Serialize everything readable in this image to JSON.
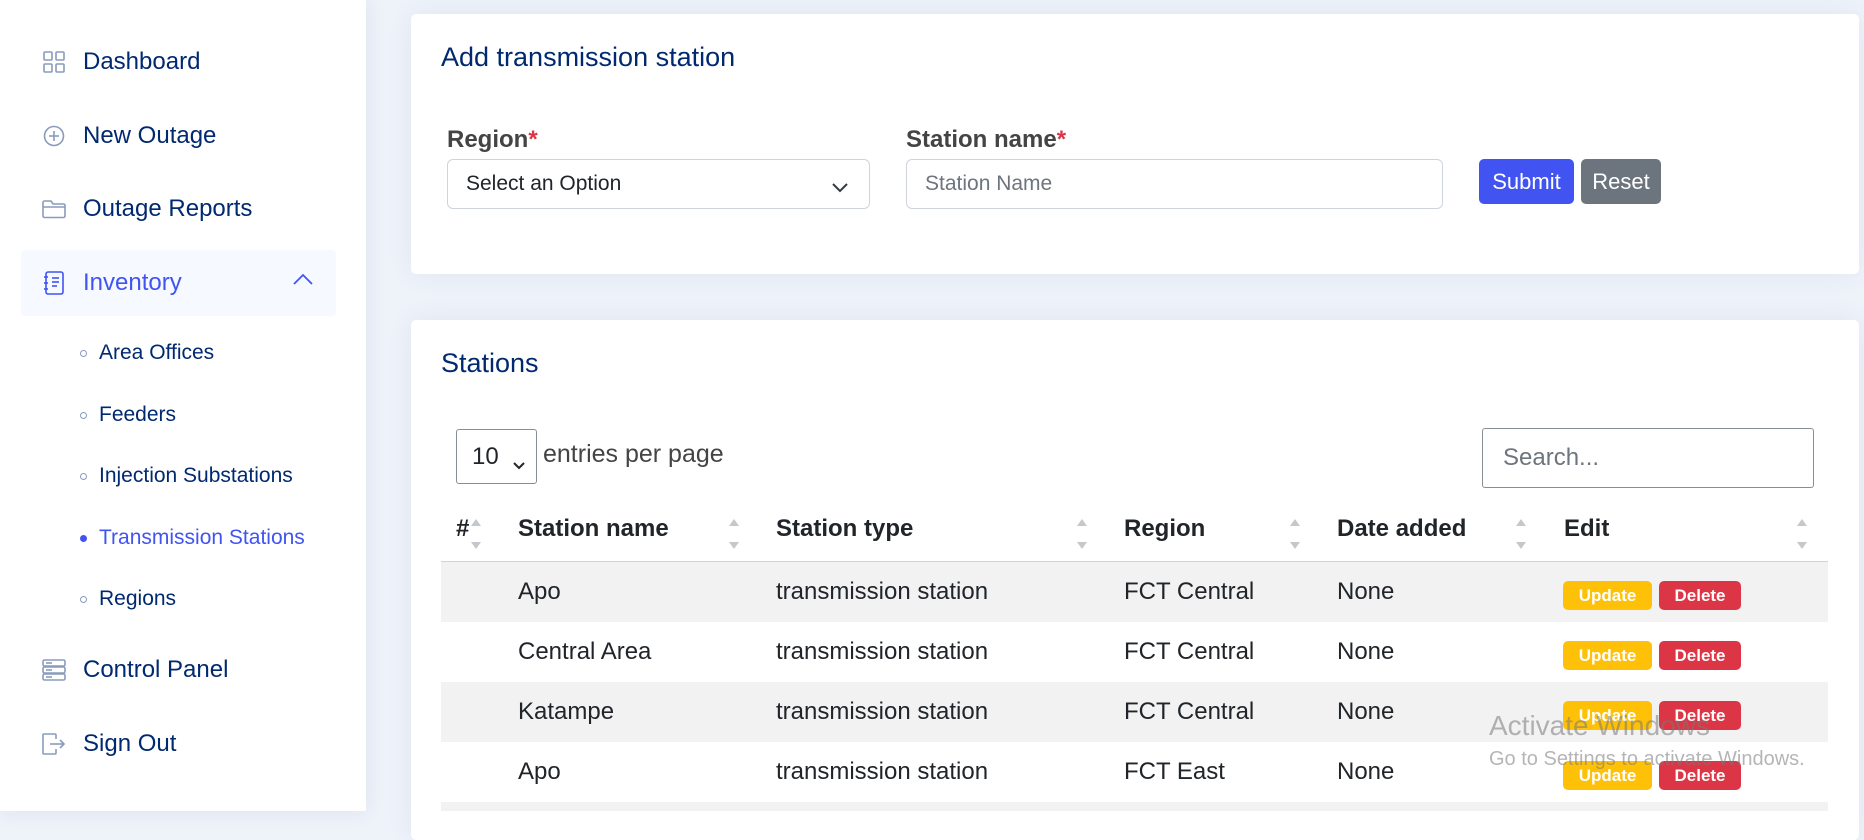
{
  "sidebar": {
    "items": [
      {
        "label": "Dashboard",
        "icon": "grid-icon"
      },
      {
        "label": "New Outage",
        "icon": "plus-circle-icon"
      },
      {
        "label": "Outage Reports",
        "icon": "folder-icon"
      },
      {
        "label": "Inventory",
        "icon": "journal-icon"
      },
      {
        "label": "Control Panel",
        "icon": "server-icon"
      },
      {
        "label": "Sign Out",
        "icon": "box-arrow-right-icon"
      }
    ],
    "inventory_children": [
      {
        "label": "Area Offices"
      },
      {
        "label": "Feeders"
      },
      {
        "label": "Injection Substations"
      },
      {
        "label": "Transmission Stations"
      },
      {
        "label": "Regions"
      }
    ]
  },
  "form": {
    "title": "Add transmission station",
    "region_label": "Region",
    "station_name_label": "Station name",
    "required_mark": "*",
    "region_selected": "Select an Option",
    "station_name_placeholder": "Station Name",
    "submit_label": "Submit",
    "reset_label": "Reset"
  },
  "stations": {
    "title": "Stations",
    "per_page": "10",
    "per_page_label": "entries per page",
    "search_placeholder": "Search...",
    "columns": [
      "#",
      "Station name",
      "Station type",
      "Region",
      "Date added",
      "Edit"
    ],
    "rows": [
      {
        "num": "",
        "name": "Apo",
        "type": "transmission station",
        "region": "FCT Central",
        "date": "None"
      },
      {
        "num": "",
        "name": "Central Area",
        "type": "transmission station",
        "region": "FCT Central",
        "date": "None"
      },
      {
        "num": "",
        "name": "Katampe",
        "type": "transmission station",
        "region": "FCT Central",
        "date": "None"
      },
      {
        "num": "",
        "name": "Apo",
        "type": "transmission station",
        "region": "FCT East",
        "date": "None"
      }
    ],
    "update_label": "Update",
    "delete_label": "Delete"
  },
  "watermark": {
    "line1": "Activate Windows",
    "line2": "Go to Settings to activate Windows."
  },
  "colors": {
    "accent": "#4154f1",
    "navy": "#012970",
    "update": "#ffc107",
    "delete": "#dc3545",
    "reset": "#6c757d"
  }
}
